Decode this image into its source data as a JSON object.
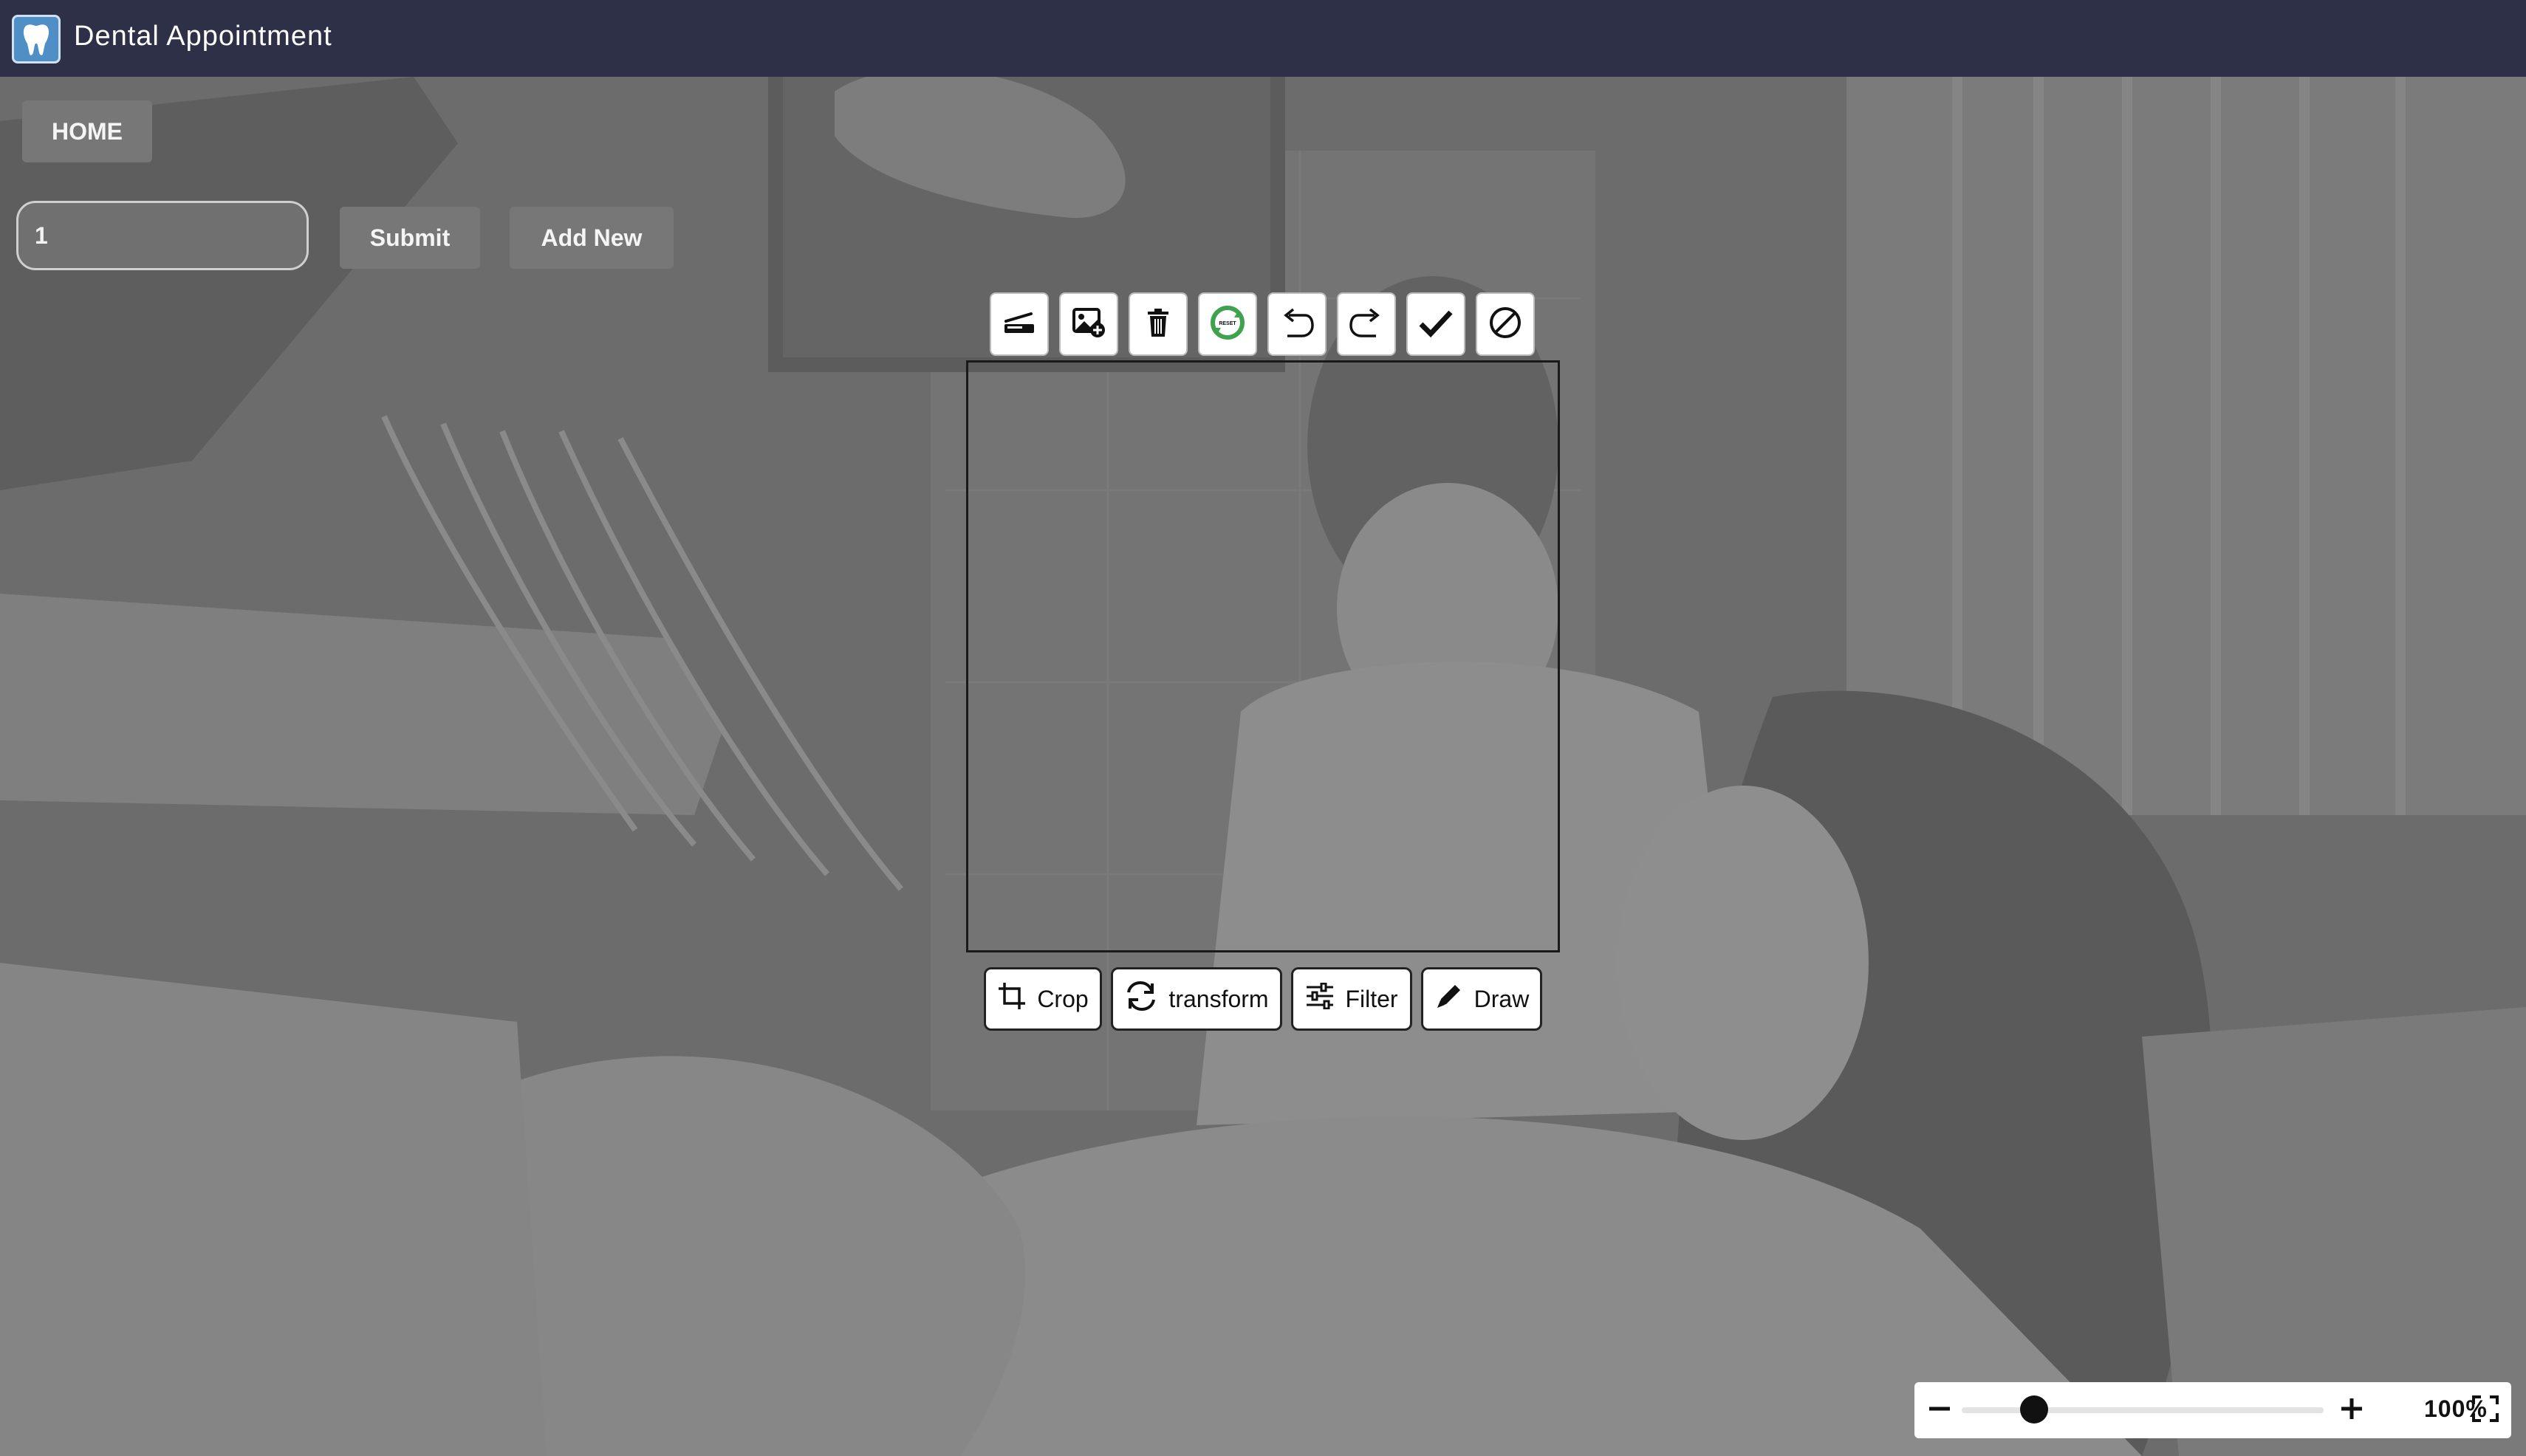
{
  "header": {
    "title": "Dental Appointment",
    "logo_icon": "tooth-logo-icon",
    "background_color": "#2e3047"
  },
  "nav": {
    "home_label": "HOME"
  },
  "form": {
    "id_value": "1",
    "submit_label": "Submit",
    "add_new_label": "Add New"
  },
  "editor": {
    "toolbar": [
      {
        "name": "load-image-button",
        "icon": "load-icon"
      },
      {
        "name": "add-image-button",
        "icon": "image-add-icon"
      },
      {
        "name": "delete-button",
        "icon": "trash-icon"
      },
      {
        "name": "reset-button",
        "icon": "reset-icon"
      },
      {
        "name": "undo-button",
        "icon": "undo-icon"
      },
      {
        "name": "redo-button",
        "icon": "redo-icon"
      },
      {
        "name": "apply-button",
        "icon": "check-icon"
      },
      {
        "name": "cancel-button",
        "icon": "cancel-icon"
      }
    ],
    "reset_icon_text": "RESET",
    "tabs": {
      "crop": "Crop",
      "transform": "transform",
      "filter": "Filter",
      "draw": "Draw"
    }
  },
  "zoom": {
    "level": 0.2,
    "label": "100%"
  },
  "colors": {
    "overlay": "#6e6e6e",
    "button_gray": "#777777",
    "reset_green": "#3fa34d"
  }
}
